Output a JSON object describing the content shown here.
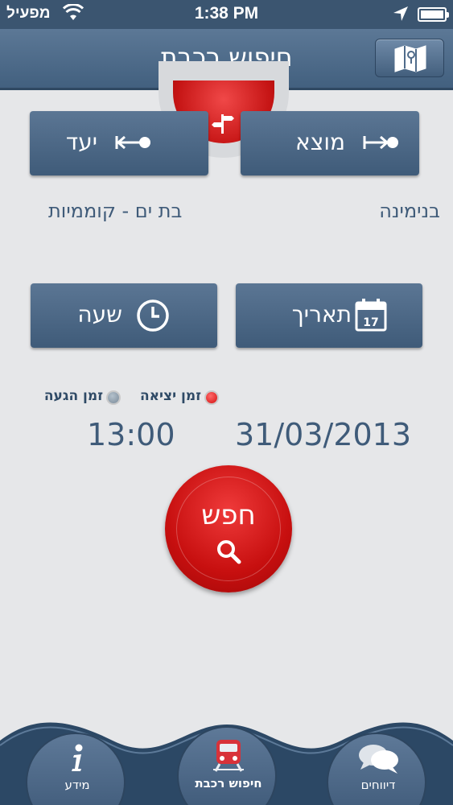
{
  "status_bar": {
    "carrier": "מפעיל",
    "time": "1:38 PM"
  },
  "nav": {
    "title": "חיפוש רכבת"
  },
  "route": {
    "origin_label": "מוצא",
    "destination_label": "יעד",
    "origin_station": "בנימינה",
    "destination_station": "בת ים - קוממיות"
  },
  "datetime": {
    "date_label": "תאריך",
    "time_label": "שעה",
    "calendar_day": "17",
    "departure_option": "זמן יציאה",
    "arrival_option": "זמן הגעה",
    "selected_option": "departure",
    "date_value": "31/03/2013",
    "time_value": "13:00"
  },
  "search": {
    "label": "חפש"
  },
  "tabs": [
    {
      "label": "מידע",
      "icon": "info-icon"
    },
    {
      "label": "חיפוש רכבת",
      "icon": "train-icon"
    },
    {
      "label": "דיווחים",
      "icon": "chat-bubbles-icon"
    }
  ],
  "colors": {
    "primary": "#4a6685",
    "accent_red": "#c70f0f",
    "background": "#e6e7e9",
    "text_blue": "#3f5b79"
  }
}
